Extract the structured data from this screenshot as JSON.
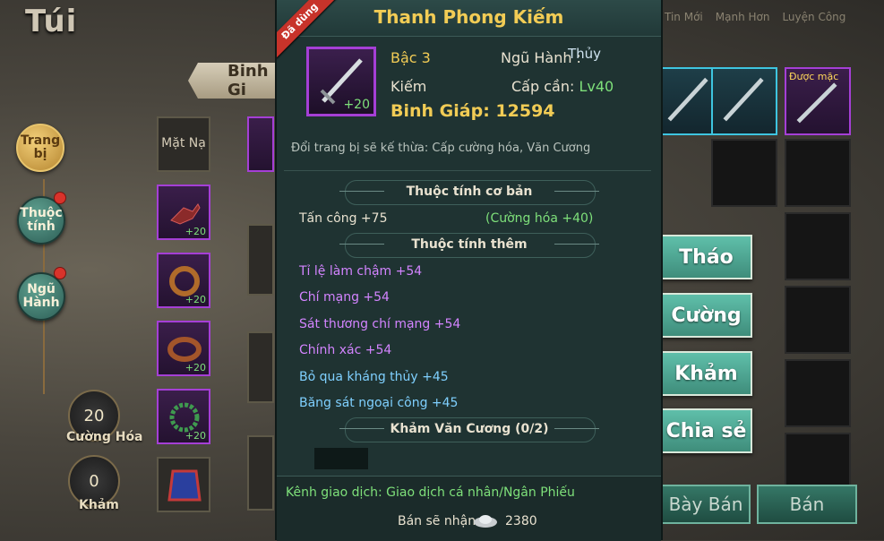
{
  "bag_title": "Túi",
  "top_tabs": [
    "Tin Mới",
    "Mạnh Hơn",
    "Luyện Công"
  ],
  "side_menu": [
    {
      "label_1": "Trang",
      "label_2": "bị",
      "active": true
    },
    {
      "label_1": "Thuộc",
      "label_2": "tính",
      "active": false
    },
    {
      "label_1": "Ngũ",
      "label_2": "Hành",
      "active": false
    }
  ],
  "stats": [
    {
      "value": "20",
      "label": "Cường Hóa"
    },
    {
      "value": "0",
      "label": "Khảm"
    }
  ],
  "equip_tab_label": "Binh Gi",
  "left_slots": {
    "mask_label": "Mặt Nạ",
    "plus_values": [
      "+20",
      "+20",
      "+20",
      "+20"
    ]
  },
  "right_grid": {
    "tag_label": "Được mặc"
  },
  "actions": [
    "Tháo",
    "Cường",
    "Khảm",
    "Chia sẻ"
  ],
  "bottom_buttons": [
    "Bày Bán",
    "Bán"
  ],
  "item": {
    "name": "Thanh Phong Kiếm",
    "used_badge": "Đã dùng",
    "enhance": "+20",
    "tier": "Bậc 3",
    "element_label": "Ngũ Hành :",
    "element_value": "Thủy",
    "type": "Kiếm",
    "req_label": "Cấp cần: ",
    "req_level": "Lv40",
    "power": "Binh Giáp: 12594",
    "note": "Đổi trang bị sẽ kế thừa: Cấp cường hóa, Văn Cương",
    "basic_title": "Thuộc tính cơ bản",
    "basic_attr": "Tấn công +75",
    "basic_bonus": "(Cường hóa +40)",
    "extra_title": "Thuộc tính thêm",
    "extra_attrs": [
      "Tỉ lệ làm chậm +54",
      "Chí mạng +54",
      "Sát thương chí mạng +54",
      "Chính xác +54",
      "Bỏ qua kháng thủy +45",
      "Băng sát ngoại công +45"
    ],
    "gem_title": "Khảm Văn Cương (0/2)",
    "trade_channel": "Kênh giao dịch: Giao dịch cá nhân/Ngân Phiếu",
    "sell_label": "Bán sẽ nhận:",
    "sell_value": "2380"
  }
}
